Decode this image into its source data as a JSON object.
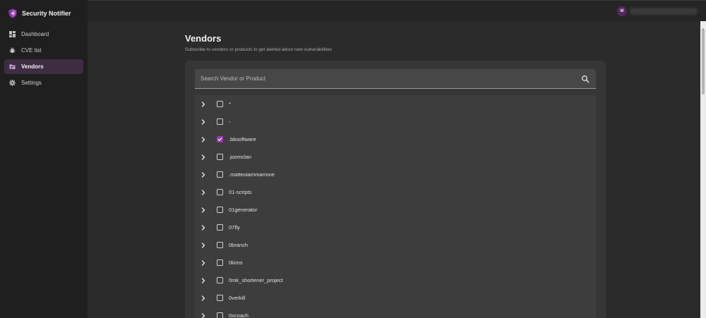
{
  "app": {
    "title": "Security Notifier"
  },
  "sidebar": {
    "items": [
      {
        "label": "Dashboard",
        "icon": "dashboard-icon",
        "active": false
      },
      {
        "label": "CVE list",
        "icon": "bug-icon",
        "active": false
      },
      {
        "label": "Vendors",
        "icon": "folder-icon",
        "active": true
      },
      {
        "label": "Settings",
        "icon": "gear-icon",
        "active": false
      }
    ]
  },
  "topbar": {
    "avatar_letter": "M"
  },
  "page": {
    "title": "Vendors",
    "subtitle": "Subscribe to vendors or products to get alerted about new vulnerabilities"
  },
  "search": {
    "placeholder": "Search Vendor or Product",
    "value": ""
  },
  "vendors": [
    {
      "name": "*",
      "checked": false
    },
    {
      "name": "-",
      "checked": false
    },
    {
      "name": ".bbsoftware",
      "checked": true
    },
    {
      "name": ".joomclan",
      "checked": false
    },
    {
      "name": ".matteoiammarrone",
      "checked": false
    },
    {
      "name": "01-scripts",
      "checked": false
    },
    {
      "name": "01generator",
      "checked": false
    },
    {
      "name": "07fly",
      "checked": false
    },
    {
      "name": "0branch",
      "checked": false
    },
    {
      "name": "0kims",
      "checked": false
    },
    {
      "name": "0mk_shortener_project",
      "checked": false
    },
    {
      "name": "0verkill",
      "checked": false
    },
    {
      "name": "0xcoach",
      "checked": false
    }
  ],
  "colors": {
    "accent": "#9b3ab0",
    "active_nav": "#3e2d43",
    "avatar": "#53285f"
  }
}
